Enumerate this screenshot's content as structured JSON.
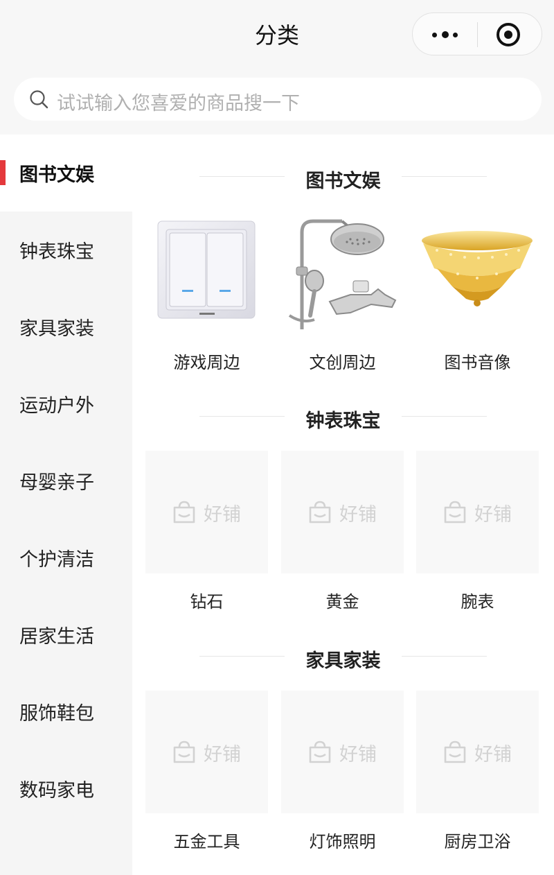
{
  "navbar": {
    "title": "分类"
  },
  "search": {
    "placeholder": "试试输入您喜爱的商品搜一下"
  },
  "sidebar": {
    "items": [
      {
        "label": "图书文娱",
        "active": true
      },
      {
        "label": "钟表珠宝",
        "active": false
      },
      {
        "label": "家具家装",
        "active": false
      },
      {
        "label": "运动户外",
        "active": false
      },
      {
        "label": "母婴亲子",
        "active": false
      },
      {
        "label": "个护清洁",
        "active": false
      },
      {
        "label": "居家生活",
        "active": false
      },
      {
        "label": "服饰鞋包",
        "active": false
      },
      {
        "label": "数码家电",
        "active": false
      }
    ]
  },
  "sections": [
    {
      "title": "图书文娱",
      "items": [
        {
          "name": "游戏周边",
          "image": "wall-switch"
        },
        {
          "name": "文创周边",
          "image": "shower-set"
        },
        {
          "name": "图书音像",
          "image": "crystal-chandelier"
        }
      ]
    },
    {
      "title": "钟表珠宝",
      "items": [
        {
          "name": "钻石",
          "image": "placeholder"
        },
        {
          "name": "黄金",
          "image": "placeholder"
        },
        {
          "name": "腕表",
          "image": "placeholder"
        }
      ]
    },
    {
      "title": "家具家装",
      "items": [
        {
          "name": "五金工具",
          "image": "placeholder"
        },
        {
          "name": "灯饰照明",
          "image": "placeholder"
        },
        {
          "name": "厨房卫浴",
          "image": "placeholder"
        }
      ]
    }
  ],
  "placeholder_text": "好铺",
  "colors": {
    "accent": "#e4393c",
    "sidebar_bg": "#f5f5f5",
    "header_bg": "#f7f7f7"
  }
}
